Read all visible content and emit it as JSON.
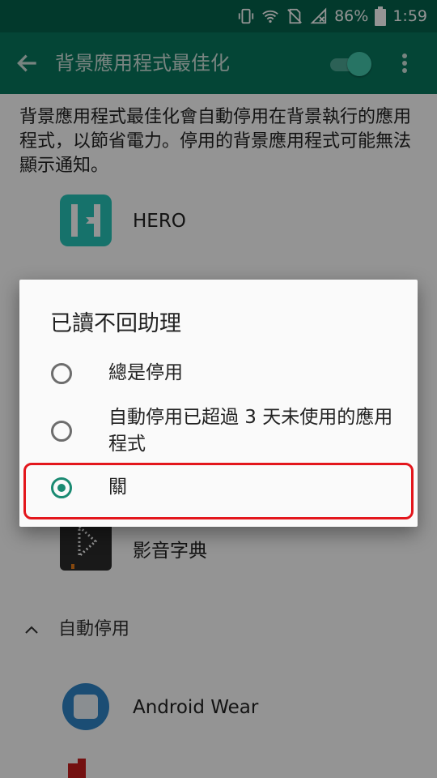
{
  "status_bar": {
    "battery": "86%",
    "time": "1:59"
  },
  "toolbar": {
    "title": "背景應用程式最佳化"
  },
  "description": "背景應用程式最佳化會自動停用在背景執行的應用程式，以節省電力。停用的背景應用程式可能無法顯示通知。",
  "apps": [
    {
      "name": "HERO"
    },
    {
      "name": "影音字典"
    }
  ],
  "section": {
    "label": "自動停用"
  },
  "auto_apps": [
    {
      "name": "Android Wear"
    }
  ],
  "dialog": {
    "title": "已讀不回助理",
    "options": [
      {
        "label": "總是停用",
        "selected": false
      },
      {
        "label": "自動停用已超過 3 天未使用的應用程式",
        "selected": false
      },
      {
        "label": "關",
        "selected": true
      }
    ]
  },
  "colors": {
    "accent": "#1a8a72",
    "toolbar": "#08775e",
    "highlight": "#e3161c"
  }
}
